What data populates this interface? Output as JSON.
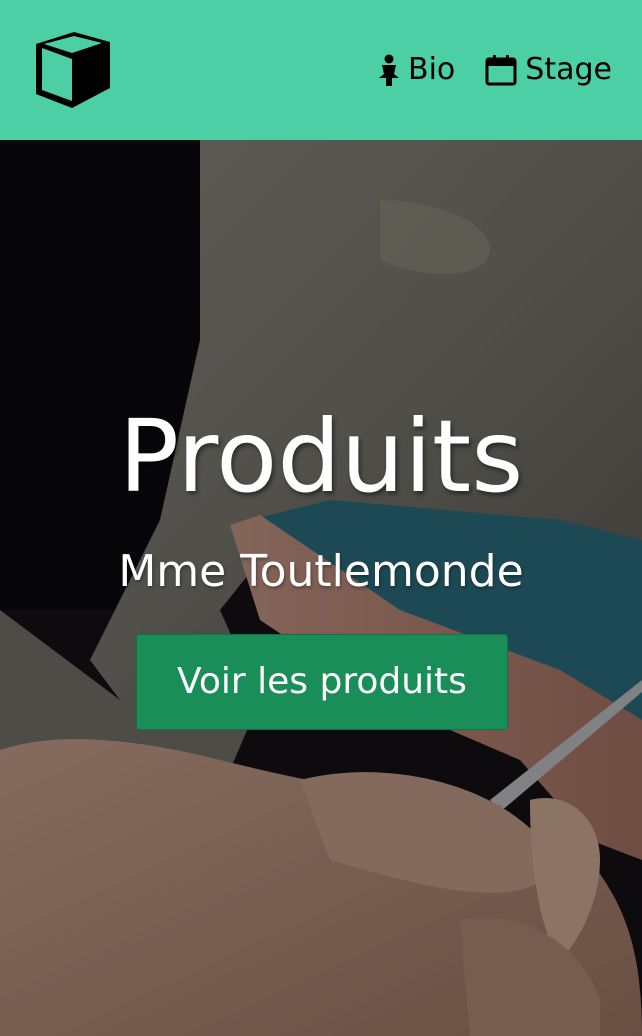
{
  "header": {
    "logo_icon": "cube-icon",
    "nav": [
      {
        "icon": "person-icon",
        "label": "Bio"
      },
      {
        "icon": "calendar-icon",
        "label": "Stage"
      }
    ],
    "background_color": "#4ccfa5"
  },
  "hero": {
    "title": "Produits",
    "subtitle": "Mme Toutlemonde",
    "button_label": "Voir les produits",
    "button_color": "#1a8e58"
  }
}
